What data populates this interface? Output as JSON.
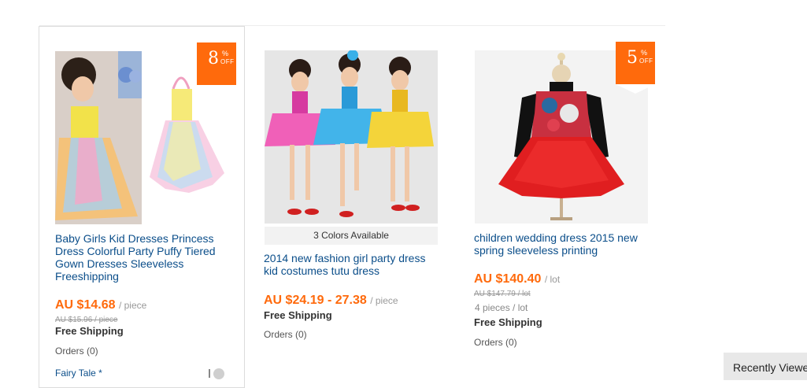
{
  "products": [
    {
      "badge": {
        "value": "8",
        "pct": "%",
        "off": "OFF"
      },
      "title": "Baby Girls Kid Dresses Princess Dress Colorful Party Puffy Tiered Gown Dresses Sleeveless Freeshipping",
      "price": "AU $14.68",
      "unit": "/ piece",
      "old_price": "AU $15.96 / piece",
      "shipping": "Free Shipping",
      "orders": "Orders (0)",
      "store": "Fairy Tale *"
    },
    {
      "colors_note": "3 Colors Available",
      "title": "2014 new fashion girl party dress kid costumes tutu dress",
      "price": "AU $24.19 - 27.38",
      "unit": "/ piece",
      "shipping": "Free Shipping",
      "orders": "Orders (0)"
    },
    {
      "badge": {
        "value": "5",
        "pct": "%",
        "off": "OFF"
      },
      "title": "children wedding dress 2015 new spring sleeveless printing",
      "price": "AU $140.40",
      "unit": "/ lot",
      "old_price": "AU $147.79 / lot",
      "lot_qty": "4 pieces / lot",
      "shipping": "Free Shipping",
      "orders": "Orders (0)"
    }
  ],
  "recently_viewed": "Recently Viewed",
  "colors": {
    "accent": "#ff6a0c",
    "link": "#0b4e8a"
  }
}
